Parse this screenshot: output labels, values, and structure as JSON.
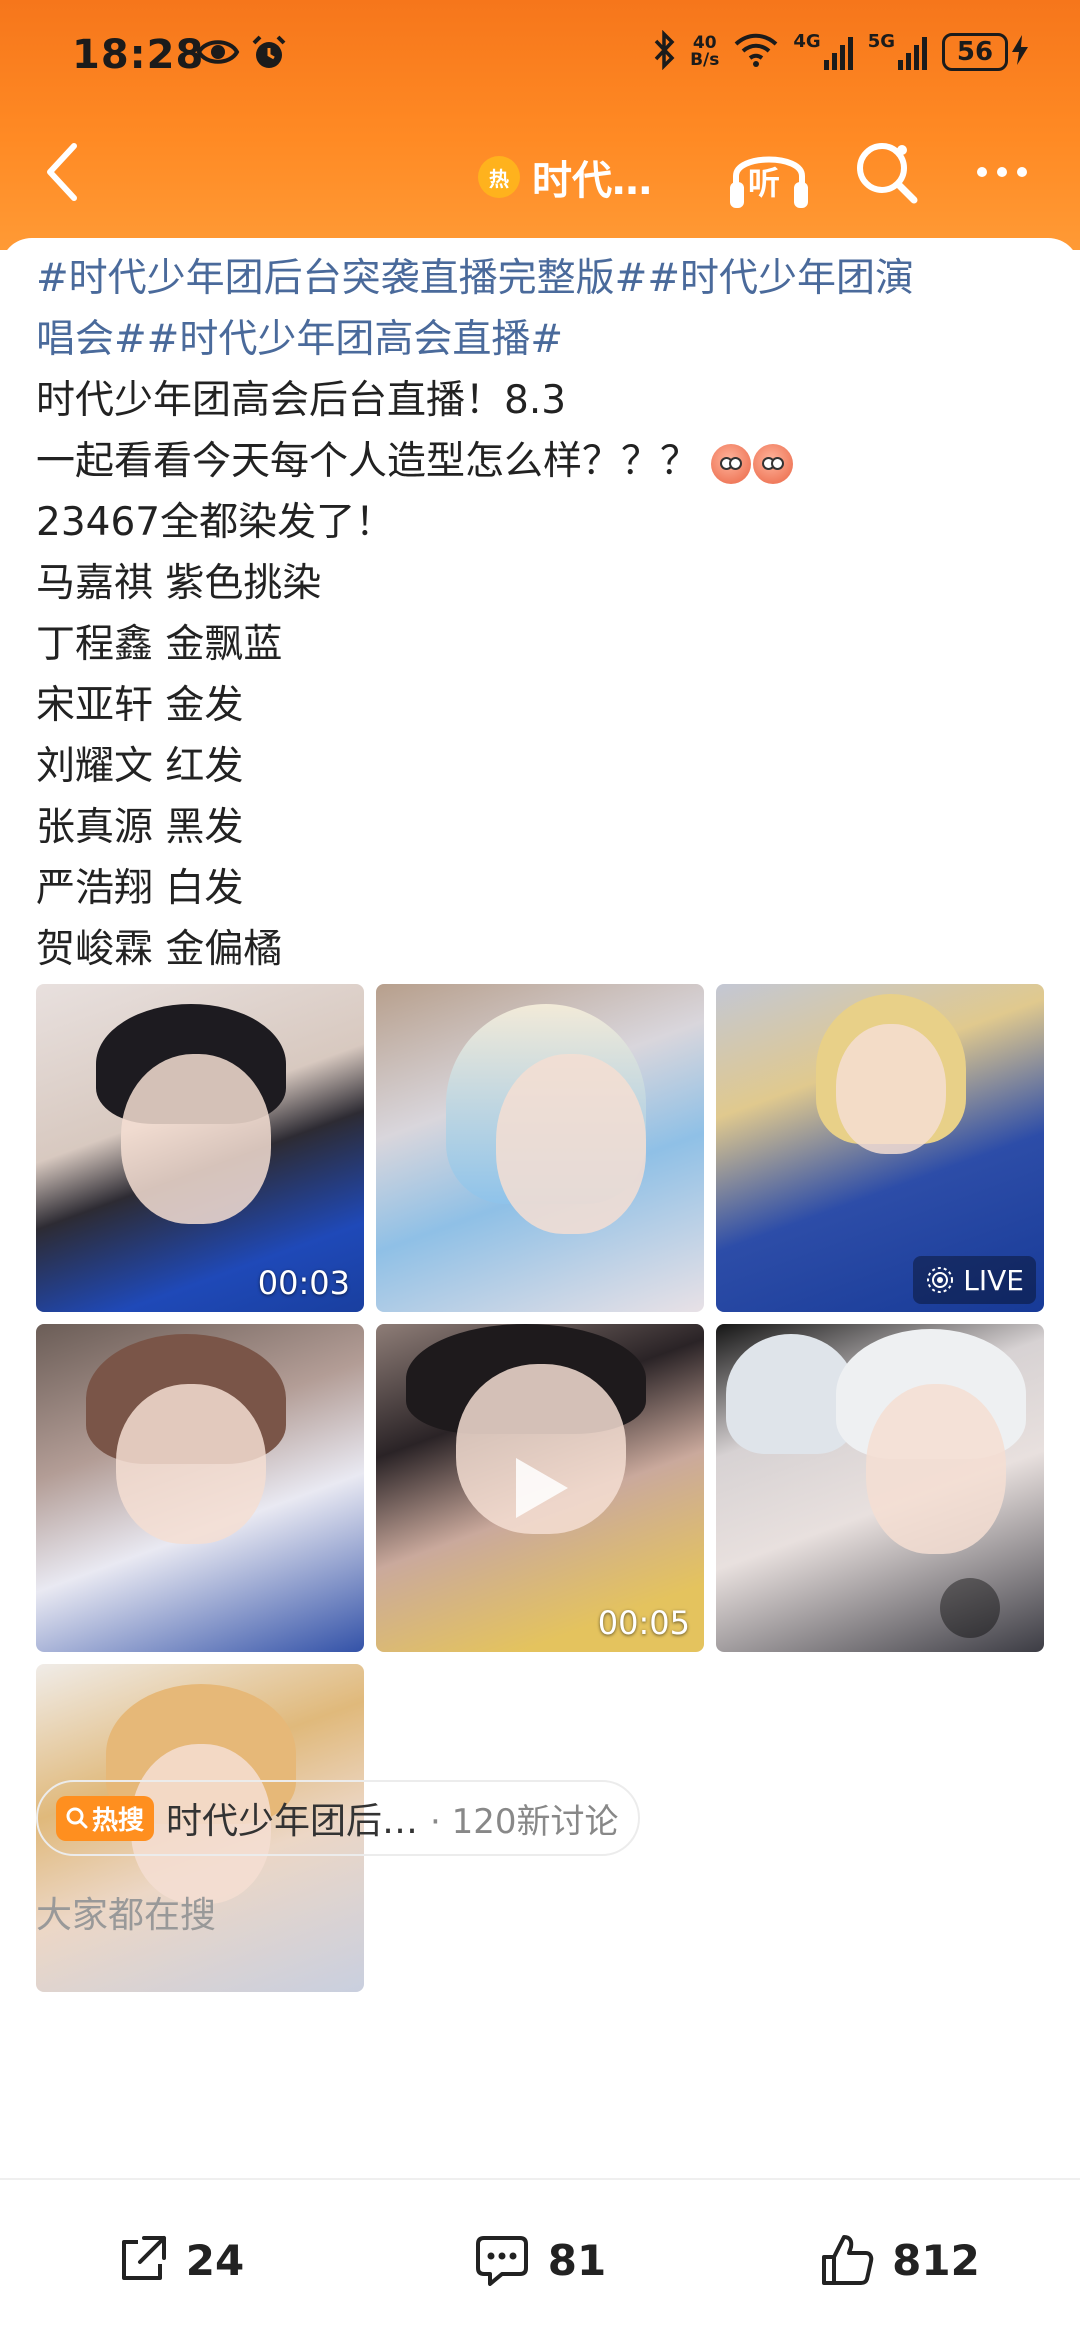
{
  "status_bar": {
    "time": "18:28",
    "speed_value": "40",
    "speed_unit": "B/s",
    "network_1": "4G",
    "network_2": "5G",
    "battery": "56"
  },
  "nav": {
    "hot_badge": "热",
    "title": "时代…",
    "listen_label": "听"
  },
  "post": {
    "topic_line_1": "#时代少年团后台突袭直播完整版##时代少年团演",
    "topic_line_2": "唱会##时代少年团高会直播#",
    "lines": [
      "时代少年团高会后台直播！8.3",
      "一起看看今天每个人造型怎么样？？？",
      "23467全都染发了！",
      "马嘉祺 紫色挑染",
      "丁程鑫 金飘蓝",
      "宋亚轩 金发",
      "刘耀文  红发",
      "张真源  黑发",
      "严浩翔  白发",
      "贺峻霖  金偏橘"
    ]
  },
  "photos": {
    "p1_duration": "00:03",
    "p3_live": "LIVE",
    "p5_duration": "00:05"
  },
  "hot_search": {
    "badge": "热搜",
    "title": "时代少年团后…",
    "count": "· 120新讨论"
  },
  "section_label": "大家都在搜",
  "actions": {
    "share_count": "24",
    "comment_count": "81",
    "like_count": "812"
  },
  "colors": {
    "header_orange": "#f6761b",
    "topic_blue": "#4a6a9b",
    "hot_orange": "#ff8f1f"
  }
}
